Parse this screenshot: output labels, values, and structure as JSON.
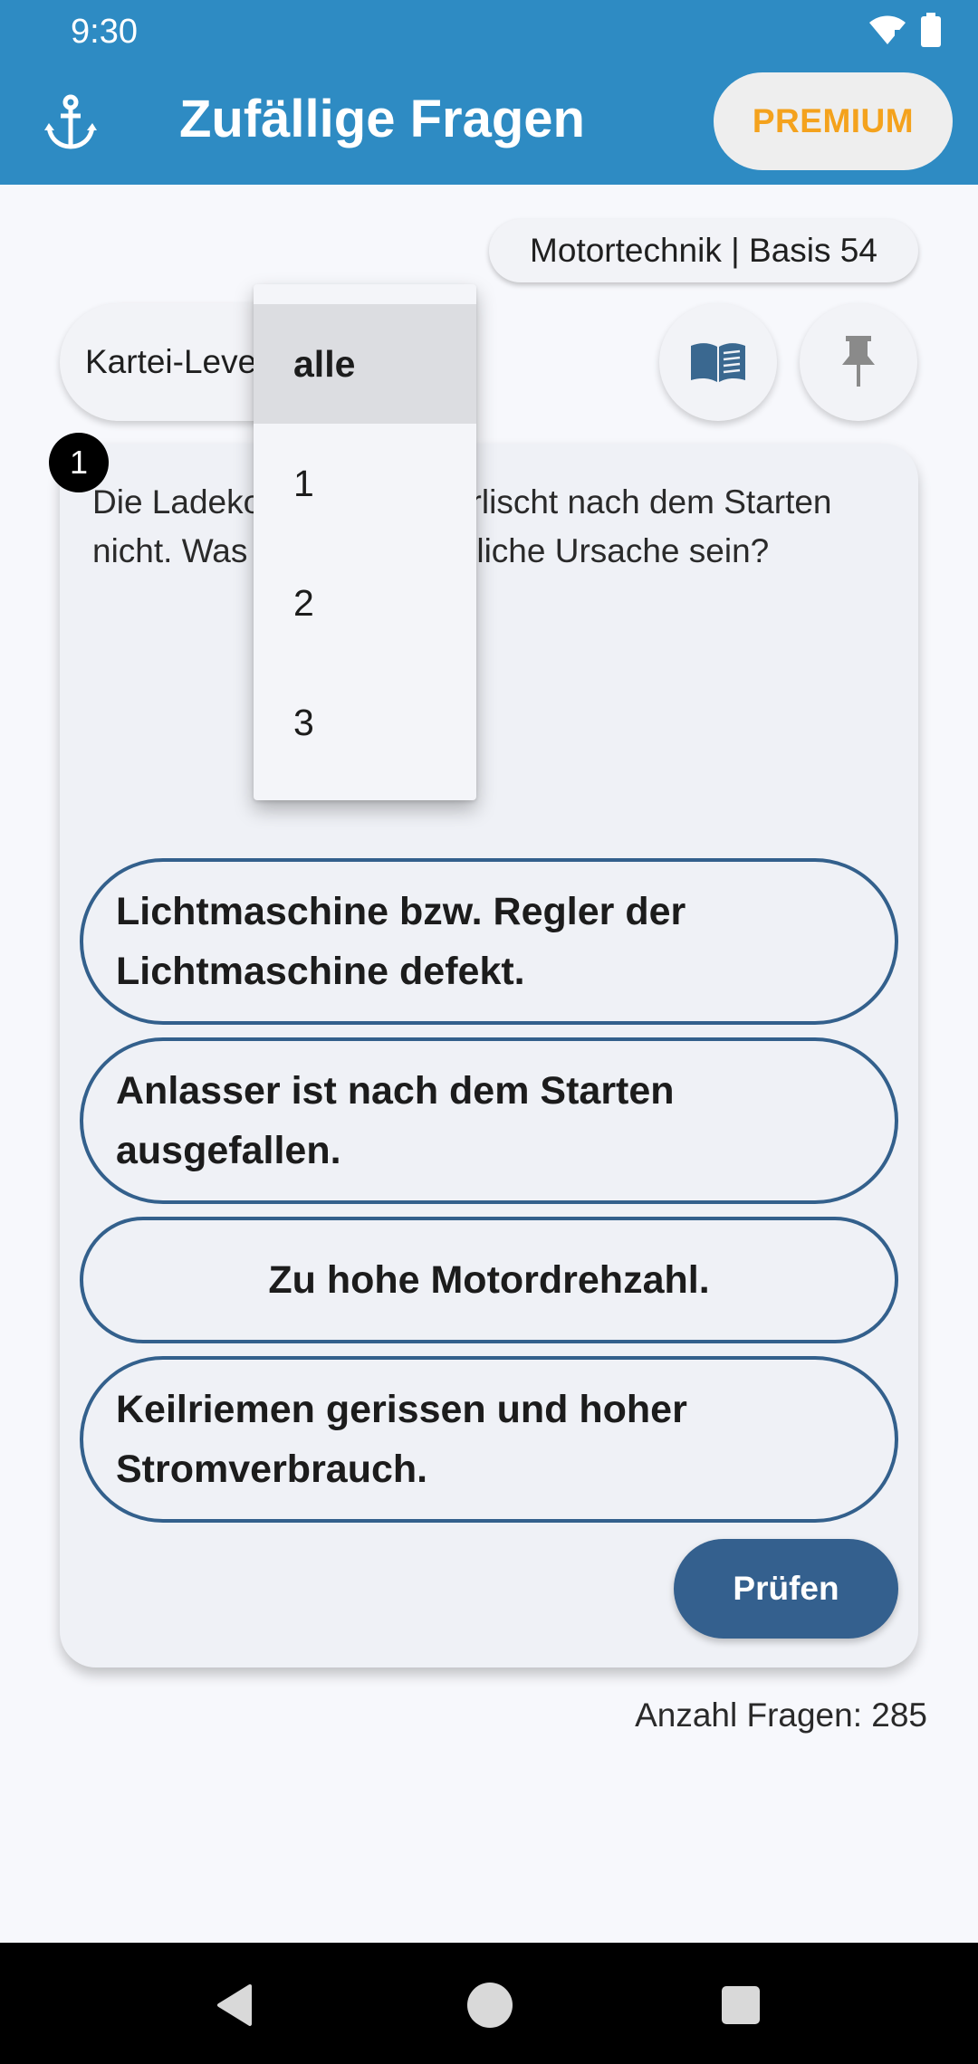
{
  "status_bar": {
    "time": "9:30"
  },
  "header": {
    "title": "Zufällige Fragen",
    "premium_label": "PREMIUM"
  },
  "tag": "Motortechnik | Basis 54",
  "level_select": {
    "label": "Kartei-Level"
  },
  "question": {
    "number": "1",
    "text": "Die Ladekontrollleuchte erlischt nach dem Starten nicht. Was kann eine mögliche Ursache sein?",
    "answers": [
      "Lichtmaschine bzw. Regler der Lichtmaschine defekt.",
      "Anlasser ist nach dem Starten ausgefallen.",
      "Zu hohe Motordrehzahl.",
      "Keilriemen gerissen und hoher Stromverbrauch."
    ],
    "check_label": "Prüfen"
  },
  "count_label": "Anzahl Fragen: 285",
  "dropdown": {
    "options": [
      "alle",
      "1",
      "2",
      "3"
    ],
    "selected": "alle"
  },
  "colors": {
    "app_bar": "#2e8bc3",
    "premium_text": "#f4a21d",
    "answer_border": "#33608c",
    "check_button": "#34608e"
  },
  "icons": [
    "anchor-icon",
    "wifi-icon",
    "battery-icon",
    "book-icon",
    "pin-icon",
    "back-icon",
    "home-icon",
    "recents-icon"
  ]
}
